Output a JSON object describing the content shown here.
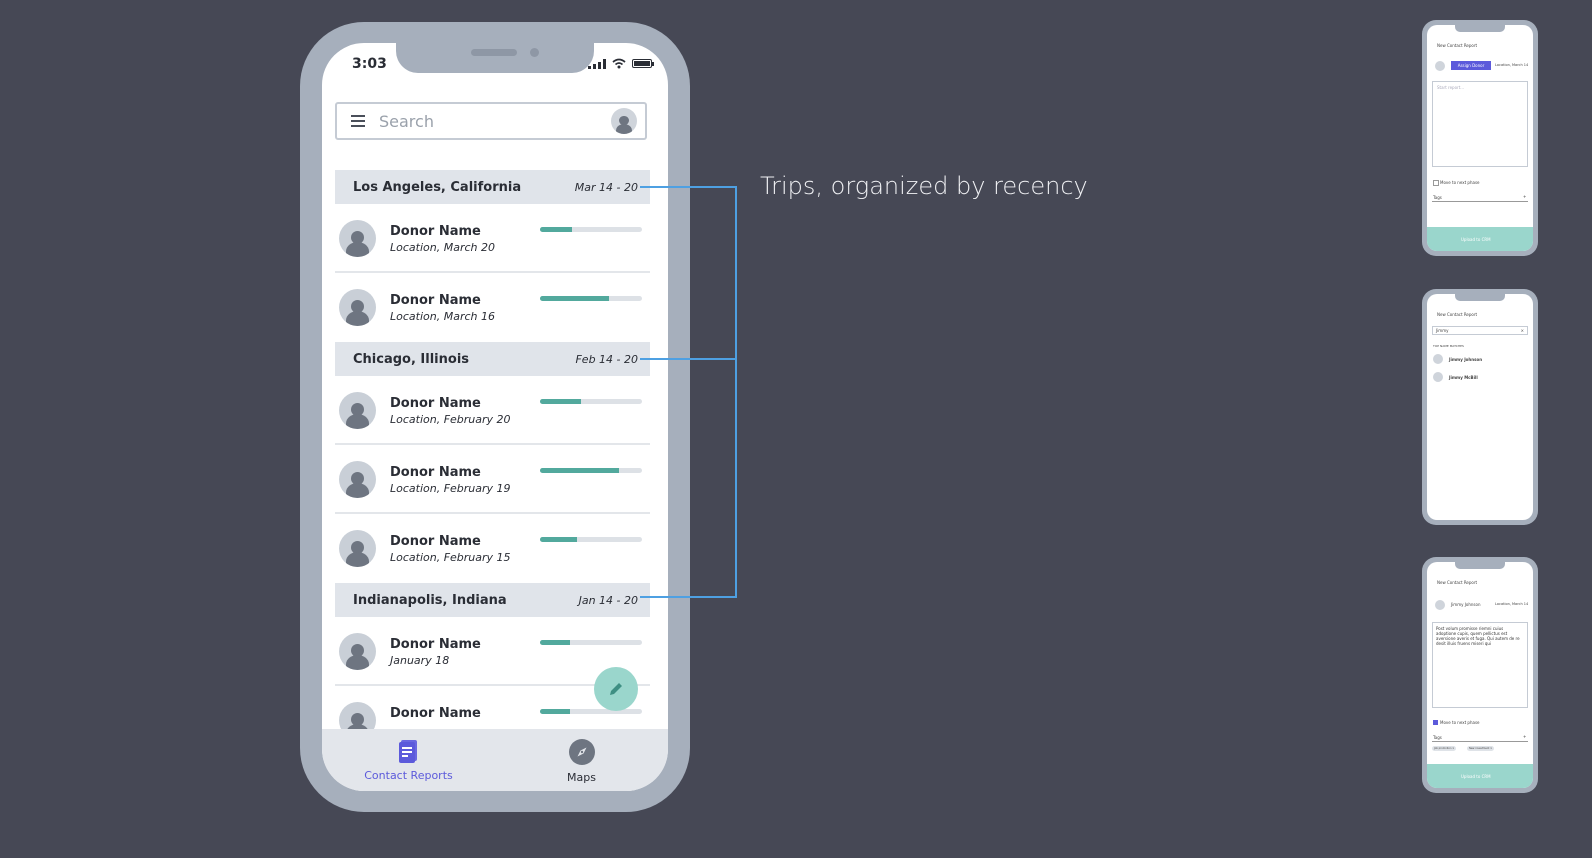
{
  "phone": {
    "time": "3:03",
    "search_placeholder": "Search",
    "sections": [
      {
        "city": "Los Angeles, California",
        "dates": "Mar 14 - 20",
        "contacts": [
          {
            "name": "Donor Name",
            "detail": "Location, March 20",
            "progress": 0.31
          },
          {
            "name": "Donor Name",
            "detail": "Location, March 16",
            "progress": 0.68
          }
        ]
      },
      {
        "city": "Chicago, Illinois",
        "dates": "Feb 14 - 20",
        "contacts": [
          {
            "name": "Donor Name",
            "detail": "Location, February 20",
            "progress": 0.4
          },
          {
            "name": "Donor Name",
            "detail": "Location, February 19",
            "progress": 0.77
          },
          {
            "name": "Donor Name",
            "detail": "Location, February 15",
            "progress": 0.36
          }
        ]
      },
      {
        "city": "Indianapolis, Indiana",
        "dates": "Jan 14 - 20",
        "contacts": [
          {
            "name": "Donor Name",
            "detail": "January 18",
            "progress": 0.29
          },
          {
            "name": "Donor Name",
            "detail": "",
            "progress": 0.29
          }
        ]
      }
    ],
    "tabs": [
      {
        "label": "Contact Reports",
        "icon": "document-icon",
        "active": true
      },
      {
        "label": "Maps",
        "icon": "compass-icon",
        "active": false
      }
    ],
    "fab_icon": "pencil-icon"
  },
  "annotation": {
    "text": "Trips, organized by recency"
  },
  "thumbnails": [
    {
      "title": "New Contact Report",
      "assign_button": "Assign Donor",
      "location": "Location, March 14",
      "placeholder": "Start report...",
      "checkbox": "Move to next phase",
      "tags": "Tags",
      "upload": "Upload to CRM"
    },
    {
      "title": "New Contact Report",
      "search_value": "Jimmy",
      "section": "TOP NAME MATCHES",
      "matches": [
        "Jimmy Johnson",
        "Jimmy McBill"
      ]
    },
    {
      "title": "New Contact Report",
      "donor": "Jimmy Johnson",
      "location": "Location, March 14",
      "report": "Post volum promisse riemni cuius adoptione cupis, quem pellictus est aversione averis et fuga. Qui autem de re desit illuis fruens miseri qui",
      "checkbox": "Move to next phase",
      "tags": "Tags",
      "tag_chips": [
        "Job promotion ×",
        "New investment ×"
      ],
      "upload": "Upload to CRM"
    }
  ],
  "colors": {
    "background": "#464855",
    "accent": "#5c5adb",
    "progress": "#52a99d",
    "fab": "#9ad6cc",
    "callout": "#4ea0e2"
  }
}
